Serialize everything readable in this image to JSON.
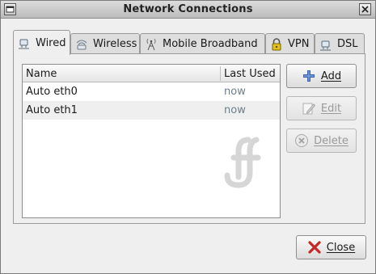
{
  "window": {
    "title": "Network Connections"
  },
  "tabs": [
    {
      "label": "Wired",
      "icon": "wired-icon"
    },
    {
      "label": "Wireless",
      "icon": "wireless-icon"
    },
    {
      "label": "Mobile Broadband",
      "icon": "antenna-icon"
    },
    {
      "label": "VPN",
      "icon": "lock-icon"
    },
    {
      "label": "DSL",
      "icon": "dsl-icon"
    }
  ],
  "connections": {
    "columns": [
      "Name",
      "Last Used"
    ],
    "rows": [
      {
        "name": "Auto eth0",
        "last_used": "now"
      },
      {
        "name": "Auto eth1",
        "last_used": "now"
      }
    ]
  },
  "buttons": {
    "add": "Add",
    "edit": "Edit",
    "delete": "Delete",
    "close": "Close"
  },
  "colors": {
    "last_used_text": "#6c7f8c",
    "add_icon": "#3a63b0",
    "close_icon": "#c62828"
  }
}
